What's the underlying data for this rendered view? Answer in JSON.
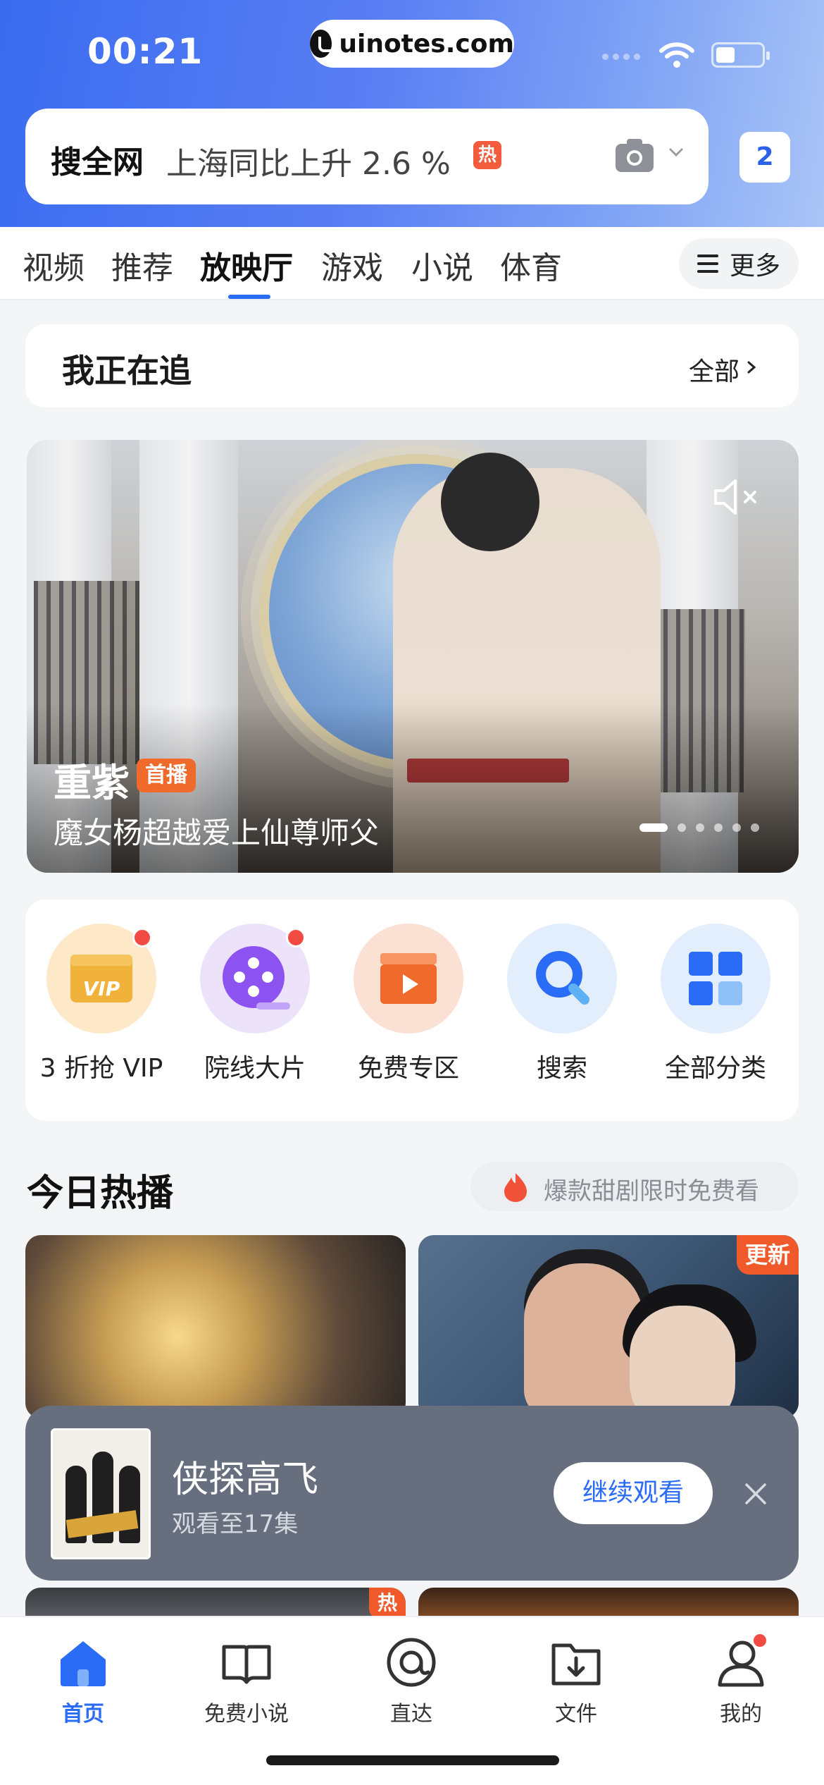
{
  "status_bar": {
    "time": "00:21",
    "url": "uinotes.com"
  },
  "search": {
    "label": "搜全网",
    "hint": "上海同比上升 2.6 %",
    "hot_tag": "热",
    "tab_count": "2"
  },
  "tabs": [
    {
      "label": "视频"
    },
    {
      "label": "推荐"
    },
    {
      "label": "放映厅"
    },
    {
      "label": "游戏"
    },
    {
      "label": "小说"
    },
    {
      "label": "体育"
    }
  ],
  "more_label": "更多",
  "following": {
    "title": "我正在追",
    "all_label": "全部"
  },
  "hero": {
    "title": "重紫",
    "badge": "首播",
    "subtitle": "魔女杨超越爱上仙尊师父",
    "slide_count": 6,
    "active_slide": 1
  },
  "shortcuts": [
    {
      "label": "3 折抢 VIP",
      "icon": "vip-ticket-icon",
      "bg": "#fde8c8",
      "badge": true
    },
    {
      "label": "院线大片",
      "icon": "film-reel-icon",
      "bg": "#ece3fb",
      "badge": true
    },
    {
      "label": "免费专区",
      "icon": "clapperboard-icon",
      "bg": "#fbe1d3",
      "badge": false
    },
    {
      "label": "搜索",
      "icon": "search-icon",
      "bg": "#e3eefd",
      "badge": false
    },
    {
      "label": "全部分类",
      "icon": "grid-icon",
      "bg": "#e3eefd",
      "badge": false
    }
  ],
  "hot_today": {
    "title": "今日热播",
    "promo": "爆款甜剧限时免费看"
  },
  "posters": {
    "badge_update": "更新",
    "badge_hot": "热"
  },
  "resume": {
    "title": "侠探高飞",
    "progress": "观看至17集",
    "button": "继续观看"
  },
  "bottom_nav": [
    {
      "label": "首页",
      "icon": "home-icon",
      "active": true
    },
    {
      "label": "免费小说",
      "icon": "book-icon",
      "active": false
    },
    {
      "label": "直达",
      "icon": "direct-icon",
      "active": false
    },
    {
      "label": "文件",
      "icon": "download-folder-icon",
      "active": false
    },
    {
      "label": "我的",
      "icon": "profile-icon",
      "active": false,
      "badge": true
    }
  ],
  "colors": {
    "accent": "#2a6cf6",
    "hot": "#f05a2a",
    "badge_red": "#f24b43"
  }
}
